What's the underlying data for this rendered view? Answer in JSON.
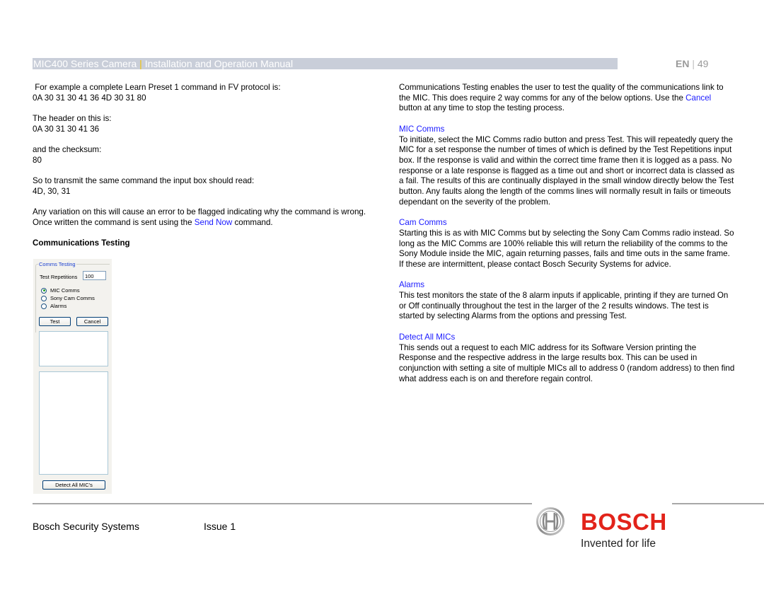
{
  "header": {
    "title_part1": "MIC400 Series Camera",
    "title_sep": "|",
    "title_part2": "Installation and Operation Manual",
    "lang": "EN",
    "page_sep": "|",
    "page_number": "49"
  },
  "left": {
    "p1_line1": " For example a complete Learn Preset 1 command in FV protocol is:",
    "p1_line2": "0A 30 31 30 41 36 4D 30 31 80",
    "p2_line1": "The header on this is:",
    "p2_line2": "0A 30 31 30 41 36",
    "p3_line1": "and the checksum:",
    "p3_line2": "80",
    "p4_line1": "So to transmit the same command the input box should read:",
    "p4_line2": "4D, 30, 31",
    "p5_text_a": "Any variation on this will cause an error to be flagged indicating why the command is wrong. Once written the command is sent using the ",
    "p5_link": "Send Now",
    "p5_text_b": " command.",
    "section_heading": "Communications Testing"
  },
  "dialog": {
    "group_title": "Comms Testing",
    "reps_label": "Test Repetitions",
    "reps_value": "100",
    "options": [
      {
        "label": "MIC Comms",
        "selected": true
      },
      {
        "label": "Sony Cam Comms",
        "selected": false
      },
      {
        "label": "Alarms",
        "selected": false
      }
    ],
    "test_button": "Test",
    "cancel_button": "Cancel",
    "detect_button": "Detect All MIC's"
  },
  "right": {
    "intro_a": "Communications Testing enables the user to test the quality of the communications link to the MIC. This does require 2 way comms for any of the below options. Use the ",
    "intro_link": "Cancel",
    "intro_b": " button at any time to stop the testing process.",
    "sections": [
      {
        "title": "MIC Comms",
        "body": "To initiate, select the MIC Comms radio button and press Test. This will repeatedly query the MIC for a set response the number of times of which is defined by the Test Repetitions input box. If the response is valid and within the correct time frame then it is logged as a pass. No response or a late response is flagged as a time out and short or incorrect data is classed as a fail. The results of this are continually displayed in the small window directly below the Test button. Any faults along the length of the comms lines will normally result in fails or timeouts dependant on the severity of the problem."
      },
      {
        "title": "Cam Comms",
        "body": "Starting this is as with MIC Comms but by selecting the Sony Cam Comms radio instead. So long as the MIC Comms are 100% reliable this will return the reliability of the comms to the Sony Module inside the MIC, again returning passes, fails and time outs in the same frame. If these are intermittent, please contact Bosch Security Systems for advice."
      },
      {
        "title": "Alarms",
        "body": "This test monitors the state of the 8 alarm inputs if applicable, printing if they are turned On or Off continually throughout the test in the larger of the 2 results windows. The test is started by selecting Alarms from the options and pressing Test."
      },
      {
        "title": "Detect All MICs",
        "body": "This sends out a request to each MIC address for its Software Version printing the Response and the respective address in the large results box. This can be used in conjunction with setting a site of multiple MICs all to address 0 (random address) to then find what address each is on and therefore regain control."
      }
    ]
  },
  "footer": {
    "company": "Bosch Security Systems",
    "issue": "Issue 1",
    "brand": "BOSCH",
    "tagline": "Invented for life",
    "brand_color": "#e2231a"
  }
}
